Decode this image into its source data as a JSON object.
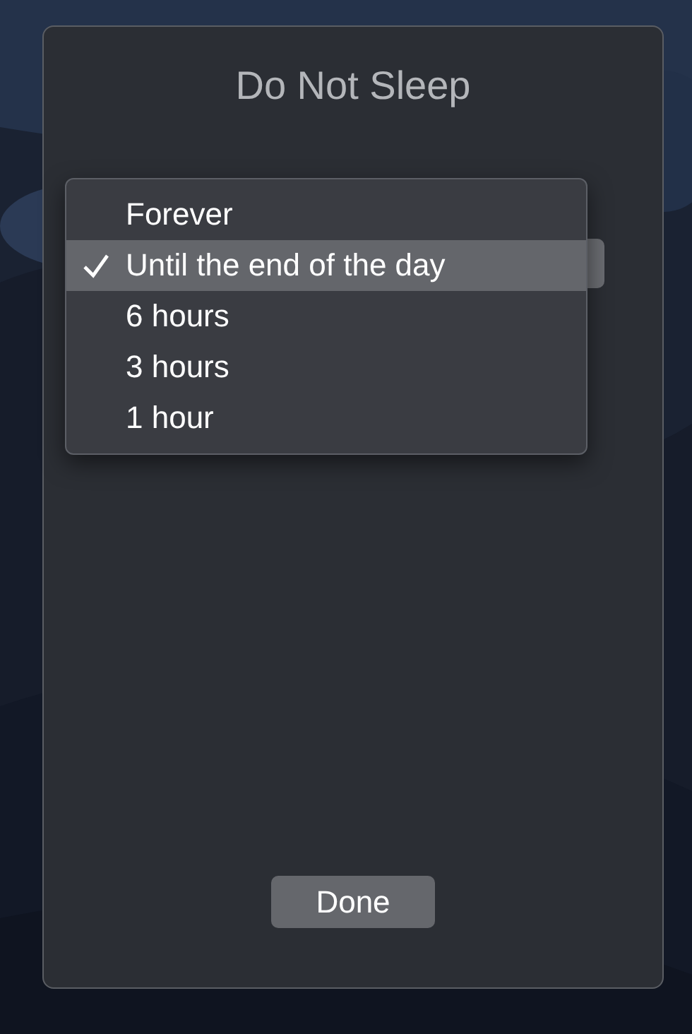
{
  "window": {
    "title": "Do Not Sleep"
  },
  "menu": {
    "items": [
      {
        "label": "Forever",
        "selected": false
      },
      {
        "label": "Until the end of the day",
        "selected": true
      },
      {
        "label": "6 hours",
        "selected": false
      },
      {
        "label": "3 hours",
        "selected": false
      },
      {
        "label": "1 hour",
        "selected": false
      }
    ]
  },
  "buttons": [
    {
      "label": "Done"
    }
  ]
}
